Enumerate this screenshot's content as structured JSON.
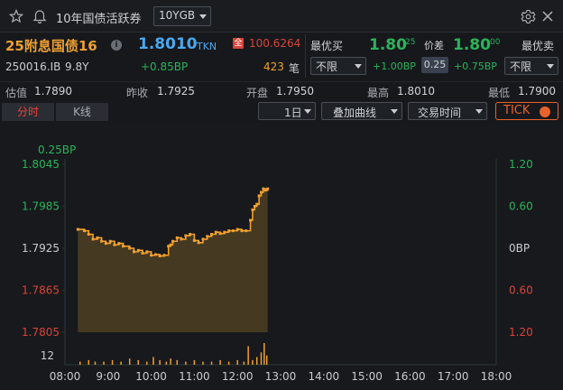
{
  "titlebar": {
    "title": "10年国债活跃券",
    "select_value": "10YGB",
    "star_icon": "star-icon",
    "bell_icon": "bell-icon",
    "gear_icon": "gear-icon",
    "close_icon": "close-icon"
  },
  "quote": {
    "name": "25附息国债16",
    "info": "i",
    "last_price": "1.8010",
    "last_type": "TKN",
    "full_badge": "全",
    "full_price": "100.6264",
    "code": "250016.IB",
    "tenor": "9.8Y",
    "change": "+0.85BP",
    "deal_count": "423",
    "deal_unit": "笔",
    "bid_label": "最优买",
    "bid_filter": "不限",
    "bid_price": "1.80",
    "bid_sup": "25",
    "bid_change": "+1.00BP",
    "spread_label": "价差",
    "spread_value": "0.25",
    "ask_price": "1.80",
    "ask_sup": "00",
    "ask_change": "+0.75BP",
    "ask_label": "最优卖",
    "ask_filter": "不限"
  },
  "stats": {
    "est_label": "估值",
    "est_value": "1.7890",
    "prev_label": "昨收",
    "prev_value": "1.7925",
    "open_label": "开盘",
    "open_value": "1.7950",
    "high_label": "最高",
    "high_value": "1.8010",
    "low_label": "最低",
    "low_value": "1.7900"
  },
  "toolbar": {
    "tab_intraday": "分时",
    "tab_kline": "K线",
    "period": "1日",
    "overlay": "叠加曲线",
    "session": "交易时间",
    "tick": "TICK"
  },
  "colors": {
    "price_line": "#f0a030",
    "up": "#2bb35a",
    "down": "#d8453a",
    "accent": "#e8622a",
    "info_blue": "#4aa8f0"
  },
  "chart_data": {
    "type": "line",
    "unit_label": "0.25BP",
    "y_left_ticks": [
      "1.8045",
      "1.7985",
      "1.7925",
      "1.7865",
      "1.7805"
    ],
    "y_right_ticks": [
      "1.20",
      "0.60",
      "0BP",
      "0.60",
      "1.20"
    ],
    "y_left_colors": [
      "#2bb35a",
      "#2bb35a",
      "#c9ccd1",
      "#d8453a",
      "#d8453a"
    ],
    "ylim": [
      1.7805,
      1.8045
    ],
    "x_ticks": [
      "08:00",
      "9:00",
      "10:00",
      "11:00",
      "12:00",
      "13:00",
      "14:00",
      "15:00",
      "16:00",
      "17:00",
      "18:00"
    ],
    "x_hours": [
      8,
      9,
      10,
      11,
      12,
      13,
      14,
      15,
      16,
      17,
      18
    ],
    "volume_tick": "12",
    "series": [
      {
        "x": [
          8.3,
          8.45,
          8.55,
          8.65,
          8.75,
          8.85,
          8.95,
          9.05,
          9.15,
          9.25,
          9.35,
          9.5,
          9.6,
          9.7,
          9.8,
          9.9,
          10.0,
          10.1,
          10.2,
          10.3,
          10.4,
          10.45,
          10.5,
          10.6,
          10.7,
          10.8,
          10.9,
          11.0,
          11.1,
          11.2,
          11.3,
          11.4,
          11.5,
          11.6,
          11.7,
          11.8,
          11.9,
          12.0,
          12.1,
          12.2,
          12.3,
          12.35,
          12.4,
          12.45,
          12.5,
          12.55,
          12.6,
          12.65,
          12.7
        ],
        "y": [
          1.7952,
          1.795,
          1.7945,
          1.7938,
          1.794,
          1.7935,
          1.7932,
          1.7935,
          1.793,
          1.7932,
          1.7928,
          1.7925,
          1.792,
          1.7922,
          1.7918,
          1.792,
          1.7915,
          1.7916,
          1.7914,
          1.7915,
          1.7928,
          1.793,
          1.7935,
          1.794,
          1.7938,
          1.7943,
          1.7945,
          1.7936,
          1.7933,
          1.7938,
          1.7942,
          1.7945,
          1.7948,
          1.7946,
          1.7948,
          1.795,
          1.795,
          1.7952,
          1.795,
          1.795,
          1.7965,
          1.798,
          1.7985,
          1.7988,
          1.8,
          1.8005,
          1.801,
          1.8008,
          1.801
        ]
      }
    ],
    "volume": {
      "x": [
        8.35,
        8.55,
        8.7,
        8.9,
        9.1,
        9.3,
        9.5,
        9.7,
        9.9,
        10.05,
        10.2,
        10.35,
        10.45,
        10.6,
        10.8,
        11.0,
        11.2,
        11.4,
        11.6,
        11.8,
        12.0,
        12.15,
        12.25,
        12.35,
        12.45,
        12.55,
        12.62,
        12.68
      ],
      "v": [
        2,
        3,
        2,
        2,
        3,
        2,
        4,
        3,
        2,
        5,
        3,
        2,
        4,
        3,
        2,
        3,
        2,
        2,
        3,
        2,
        3,
        2,
        12,
        3,
        5,
        8,
        14,
        6
      ]
    }
  }
}
